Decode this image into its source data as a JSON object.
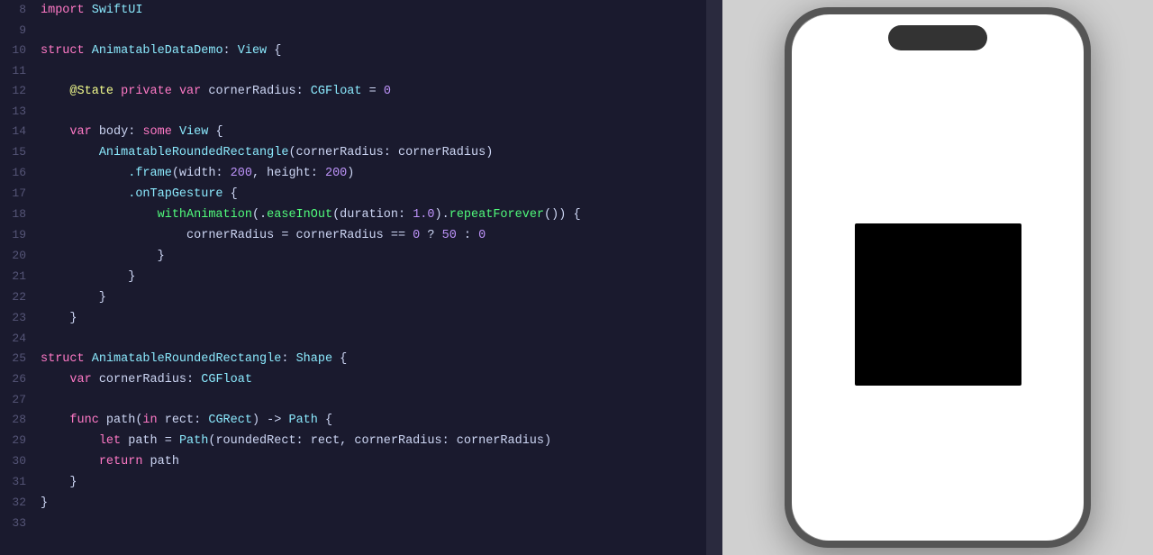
{
  "editor": {
    "background": "#1a1a2e",
    "lines": [
      {
        "num": "8",
        "tokens": [
          {
            "t": "import",
            "c": "kw-import"
          },
          {
            "t": " ",
            "c": "plain"
          },
          {
            "t": "SwiftUI",
            "c": "type-swiftui"
          }
        ]
      },
      {
        "num": "9",
        "tokens": []
      },
      {
        "num": "10",
        "tokens": [
          {
            "t": "struct",
            "c": "kw-struct"
          },
          {
            "t": " ",
            "c": "plain"
          },
          {
            "t": "AnimatableDataDemo",
            "c": "type-name"
          },
          {
            "t": ": ",
            "c": "plain"
          },
          {
            "t": "View",
            "c": "type-view"
          },
          {
            "t": " {",
            "c": "plain"
          }
        ]
      },
      {
        "num": "11",
        "tokens": []
      },
      {
        "num": "12",
        "tokens": [
          {
            "t": "    ",
            "c": "plain"
          },
          {
            "t": "@State",
            "c": "annotation"
          },
          {
            "t": " ",
            "c": "plain"
          },
          {
            "t": "private",
            "c": "kw-import"
          },
          {
            "t": " ",
            "c": "plain"
          },
          {
            "t": "var",
            "c": "kw-var"
          },
          {
            "t": " cornerRadius: ",
            "c": "plain"
          },
          {
            "t": "CGFloat",
            "c": "type-cgfloat"
          },
          {
            "t": " = ",
            "c": "plain"
          },
          {
            "t": "0",
            "c": "number"
          }
        ]
      },
      {
        "num": "13",
        "tokens": []
      },
      {
        "num": "14",
        "tokens": [
          {
            "t": "    ",
            "c": "plain"
          },
          {
            "t": "var",
            "c": "kw-var"
          },
          {
            "t": " body: ",
            "c": "plain"
          },
          {
            "t": "some",
            "c": "kw-some"
          },
          {
            "t": " ",
            "c": "plain"
          },
          {
            "t": "View",
            "c": "type-view"
          },
          {
            "t": " {",
            "c": "plain"
          }
        ]
      },
      {
        "num": "15",
        "tokens": [
          {
            "t": "        ",
            "c": "plain"
          },
          {
            "t": "AnimatableRoundedRectangle",
            "c": "type-name"
          },
          {
            "t": "(cornerRadius: cornerRadius)",
            "c": "plain"
          }
        ]
      },
      {
        "num": "16",
        "tokens": [
          {
            "t": "            ",
            "c": "plain"
          },
          {
            "t": ".frame",
            "c": "modifier"
          },
          {
            "t": "(width: ",
            "c": "plain"
          },
          {
            "t": "200",
            "c": "number"
          },
          {
            "t": ", height: ",
            "c": "plain"
          },
          {
            "t": "200",
            "c": "number"
          },
          {
            "t": ")",
            "c": "plain"
          }
        ]
      },
      {
        "num": "17",
        "tokens": [
          {
            "t": "            ",
            "c": "plain"
          },
          {
            "t": ".onTapGesture",
            "c": "modifier"
          },
          {
            "t": " {",
            "c": "plain"
          }
        ]
      },
      {
        "num": "18",
        "tokens": [
          {
            "t": "                ",
            "c": "plain"
          },
          {
            "t": "withAnimation",
            "c": "prop"
          },
          {
            "t": "(.",
            "c": "plain"
          },
          {
            "t": "easeInOut",
            "c": "prop"
          },
          {
            "t": "(duration: ",
            "c": "plain"
          },
          {
            "t": "1.0",
            "c": "number"
          },
          {
            "t": ").",
            "c": "plain"
          },
          {
            "t": "repeatForever",
            "c": "prop"
          },
          {
            "t": "()) {",
            "c": "plain"
          }
        ]
      },
      {
        "num": "19",
        "tokens": [
          {
            "t": "                    ",
            "c": "plain"
          },
          {
            "t": "cornerRadius",
            "c": "plain"
          },
          {
            "t": " = cornerRadius == ",
            "c": "plain"
          },
          {
            "t": "0",
            "c": "number"
          },
          {
            "t": " ? ",
            "c": "plain"
          },
          {
            "t": "50",
            "c": "number"
          },
          {
            "t": " : ",
            "c": "plain"
          },
          {
            "t": "0",
            "c": "number"
          }
        ]
      },
      {
        "num": "20",
        "tokens": [
          {
            "t": "                }",
            "c": "plain"
          }
        ]
      },
      {
        "num": "21",
        "tokens": [
          {
            "t": "            }",
            "c": "plain"
          }
        ]
      },
      {
        "num": "22",
        "tokens": [
          {
            "t": "        }",
            "c": "plain"
          }
        ]
      },
      {
        "num": "23",
        "tokens": [
          {
            "t": "    }",
            "c": "plain"
          }
        ]
      },
      {
        "num": "24",
        "tokens": []
      },
      {
        "num": "25",
        "tokens": [
          {
            "t": "struct",
            "c": "kw-struct"
          },
          {
            "t": " ",
            "c": "plain"
          },
          {
            "t": "AnimatableRoundedRectangle",
            "c": "type-name"
          },
          {
            "t": ": ",
            "c": "plain"
          },
          {
            "t": "Shape",
            "c": "type-shape"
          },
          {
            "t": " {",
            "c": "plain"
          }
        ]
      },
      {
        "num": "26",
        "tokens": [
          {
            "t": "    ",
            "c": "plain"
          },
          {
            "t": "var",
            "c": "kw-var"
          },
          {
            "t": " cornerRadius: ",
            "c": "plain"
          },
          {
            "t": "CGFloat",
            "c": "type-cgfloat"
          }
        ]
      },
      {
        "num": "27",
        "tokens": []
      },
      {
        "num": "28",
        "tokens": [
          {
            "t": "    ",
            "c": "plain"
          },
          {
            "t": "func",
            "c": "kw-func"
          },
          {
            "t": " path(",
            "c": "plain"
          },
          {
            "t": "in",
            "c": "kw-in"
          },
          {
            "t": " rect: ",
            "c": "plain"
          },
          {
            "t": "CGRect",
            "c": "type-cgrect"
          },
          {
            "t": ") -> ",
            "c": "plain"
          },
          {
            "t": "Path",
            "c": "type-path"
          },
          {
            "t": " {",
            "c": "plain"
          }
        ]
      },
      {
        "num": "29",
        "tokens": [
          {
            "t": "        ",
            "c": "plain"
          },
          {
            "t": "let",
            "c": "kw-let"
          },
          {
            "t": " path = ",
            "c": "plain"
          },
          {
            "t": "Path",
            "c": "type-path"
          },
          {
            "t": "(roundedRect: rect, cornerRadius: cornerRadius)",
            "c": "plain"
          }
        ]
      },
      {
        "num": "30",
        "tokens": [
          {
            "t": "        ",
            "c": "plain"
          },
          {
            "t": "return",
            "c": "kw-return"
          },
          {
            "t": " path",
            "c": "plain"
          }
        ]
      },
      {
        "num": "31",
        "tokens": [
          {
            "t": "    }",
            "c": "plain"
          }
        ]
      },
      {
        "num": "32",
        "tokens": [
          {
            "t": "}",
            "c": "plain"
          }
        ]
      },
      {
        "num": "33",
        "tokens": []
      }
    ]
  },
  "preview": {
    "backgroundColor": "#d0d0d0",
    "iphone": {
      "frameColor": "#555",
      "screenColor": "#ffffff",
      "notchColor": "#333",
      "demoRect": {
        "width": 185,
        "height": 180,
        "color": "#000000",
        "borderRadius": 2
      }
    }
  }
}
